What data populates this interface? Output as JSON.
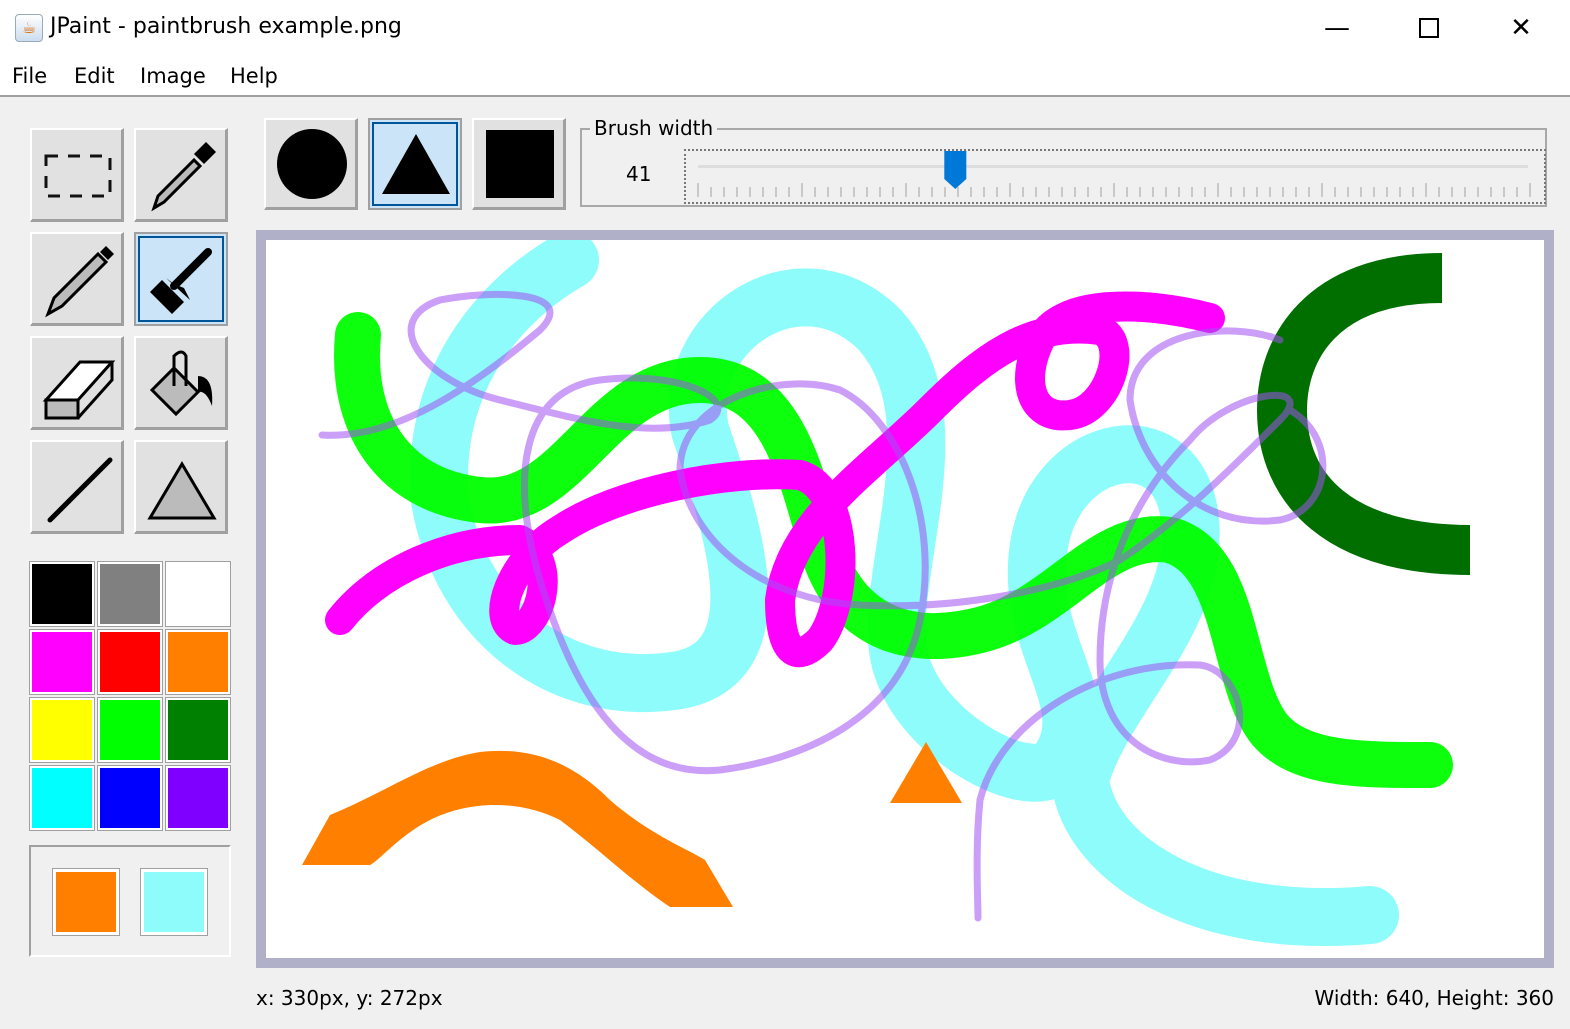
{
  "window": {
    "title": "JPaint - paintbrush example.png",
    "icon": "java-cup-icon",
    "controls": [
      "minimize-icon",
      "maximize-icon",
      "close-icon"
    ]
  },
  "menu": [
    "File",
    "Edit",
    "Image",
    "Help"
  ],
  "tools": [
    {
      "name": "select",
      "icon": "dashed-rectangle-icon",
      "selected": false
    },
    {
      "name": "eyedropper",
      "icon": "eyedropper-icon",
      "selected": false
    },
    {
      "name": "pencil",
      "icon": "pencil-icon",
      "selected": false
    },
    {
      "name": "paintbrush",
      "icon": "paintbrush-icon",
      "selected": true
    },
    {
      "name": "eraser",
      "icon": "eraser-icon",
      "selected": false
    },
    {
      "name": "fill",
      "icon": "paint-bucket-icon",
      "selected": false
    },
    {
      "name": "line",
      "icon": "line-icon",
      "selected": false
    },
    {
      "name": "shape",
      "icon": "triangle-icon",
      "selected": false
    }
  ],
  "palette": [
    "#000000",
    "#808080",
    "#ffffff",
    "#ff00ff",
    "#ff0000",
    "#ff8000",
    "#ffff00",
    "#00ff00",
    "#008000",
    "#00ffff",
    "#0000ff",
    "#8000ff"
  ],
  "current_colors": {
    "primary": "#ff8000",
    "secondary": "#8ffcfc"
  },
  "brush_shapes": [
    {
      "name": "circle",
      "selected": false
    },
    {
      "name": "triangle",
      "selected": true
    },
    {
      "name": "square",
      "selected": false
    }
  ],
  "brush_width": {
    "label": "Brush width",
    "value": "41",
    "slider_fraction": 0.31
  },
  "status": {
    "cursor": "x: 330px, y: 272px",
    "size": "Width: 640, Height: 360"
  }
}
